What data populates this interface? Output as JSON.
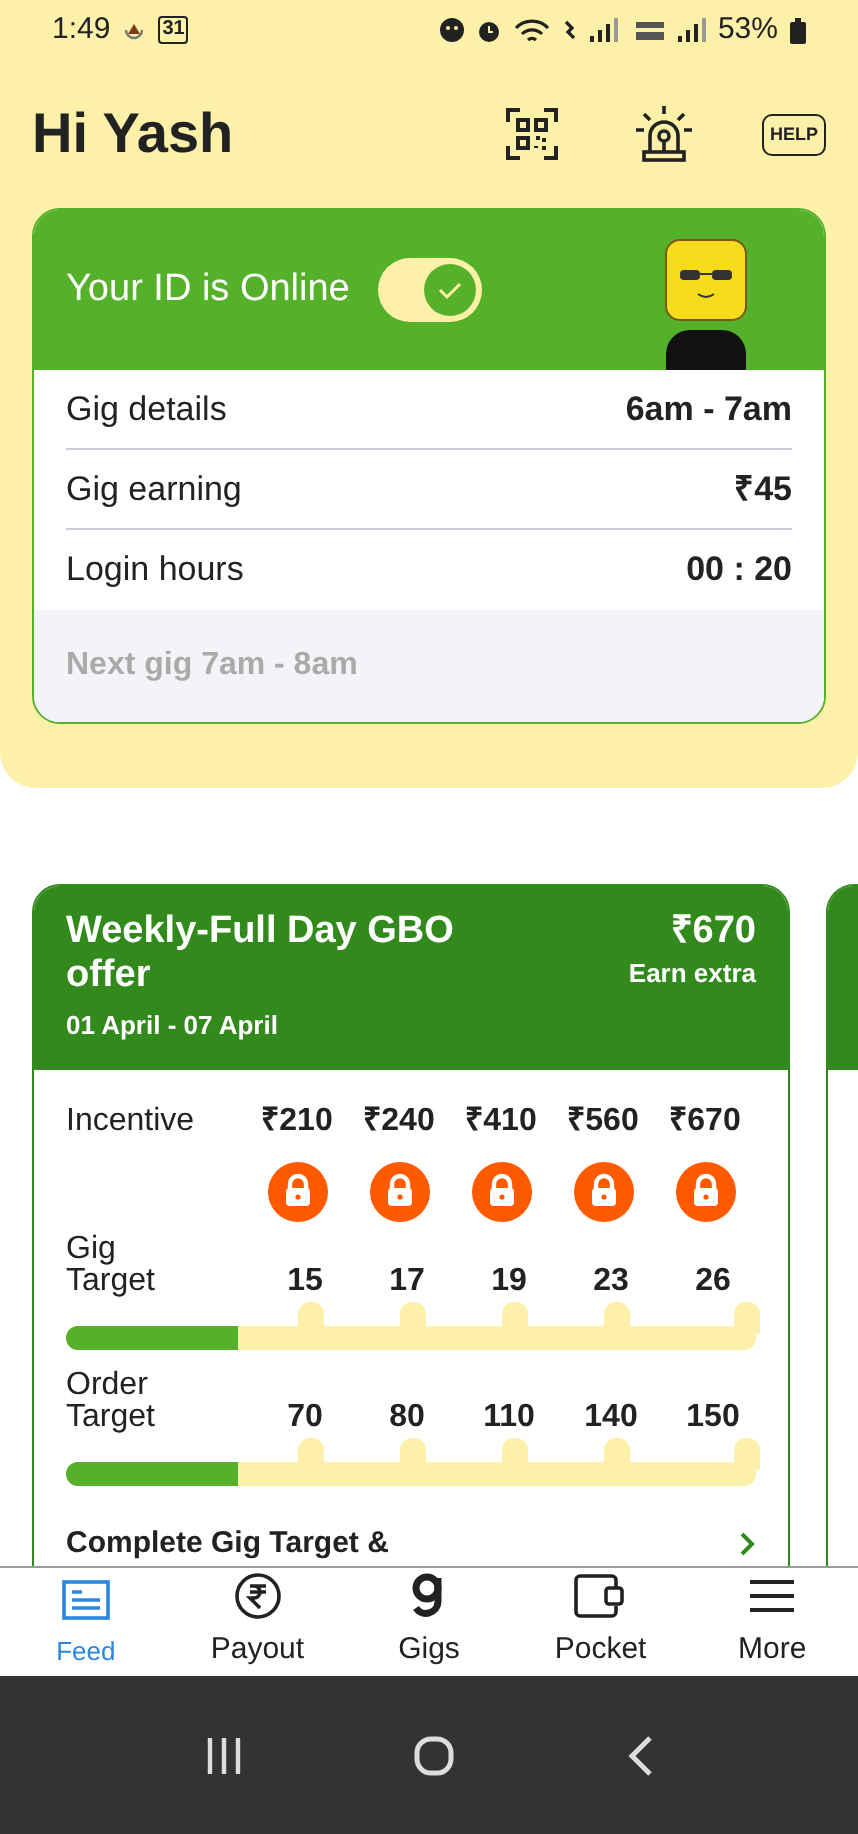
{
  "status_bar": {
    "time": "1:49",
    "calendar_day": "31",
    "battery": "53%"
  },
  "header": {
    "greeting": "Hi Yash",
    "help_label": "HELP"
  },
  "status_card": {
    "title": "Your ID is Online",
    "online": true,
    "rows": [
      {
        "label": "Gig details",
        "value": "6am - 7am"
      },
      {
        "label": "Gig earning",
        "value": "₹45"
      },
      {
        "label": "Login hours",
        "value": "00 : 20"
      }
    ],
    "next_gig": "Next gig 7am - 8am"
  },
  "offer_card": {
    "title": "Weekly-Full Day GBO offer",
    "dates": "01 April - 07 April",
    "amount": "₹670",
    "amount_caption": "Earn extra",
    "incentive_label": "Incentive",
    "milestones": [
      {
        "incentive": "₹210",
        "locked": true
      },
      {
        "incentive": "₹240",
        "locked": true
      },
      {
        "incentive": "₹410",
        "locked": true
      },
      {
        "incentive": "₹560",
        "locked": true
      },
      {
        "incentive": "₹670",
        "locked": true
      }
    ],
    "targets": [
      {
        "label": "Gig Target",
        "values": [
          "15",
          "17",
          "19",
          "23",
          "26"
        ],
        "level": 0.25
      },
      {
        "label": "Order Target",
        "values": [
          "70",
          "80",
          "110",
          "140",
          "150"
        ],
        "level": 0.25
      }
    ],
    "footer": "Complete Gig Target &"
  },
  "bottom_nav": [
    {
      "label": "Feed",
      "selected": true
    },
    {
      "label": "Payout",
      "selected": false
    },
    {
      "label": "Gigs",
      "selected": false
    },
    {
      "label": "Pocket",
      "selected": false
    },
    {
      "label": "More",
      "selected": false
    }
  ]
}
